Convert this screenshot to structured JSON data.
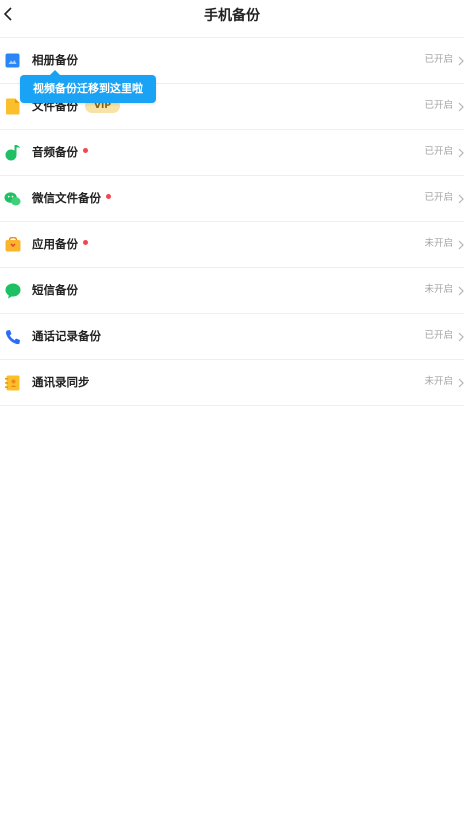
{
  "header": {
    "title": "手机备份",
    "back_icon": "chevron-left-icon"
  },
  "tooltip": {
    "text": "视频备份迁移到这里啦",
    "color": "#1aa3f5"
  },
  "items": [
    {
      "label": "相册备份",
      "status": "已开启",
      "icon": "album-icon",
      "badge": null,
      "dot": false
    },
    {
      "label": "文件备份",
      "status": "已开启",
      "icon": "file-icon",
      "badge": "VIP",
      "dot": false
    },
    {
      "label": "音频备份",
      "status": "已开启",
      "icon": "music-icon",
      "badge": null,
      "dot": true
    },
    {
      "label": "微信文件备份",
      "status": "已开启",
      "icon": "wechat-icon",
      "badge": null,
      "dot": true
    },
    {
      "label": "应用备份",
      "status": "未开启",
      "icon": "app-icon",
      "badge": null,
      "dot": true
    },
    {
      "label": "短信备份",
      "status": "未开启",
      "icon": "sms-icon",
      "badge": null,
      "dot": false
    },
    {
      "label": "通话记录备份",
      "status": "已开启",
      "icon": "phone-icon",
      "badge": null,
      "dot": false
    },
    {
      "label": "通讯录同步",
      "status": "未开启",
      "icon": "contacts-icon",
      "badge": null,
      "dot": false
    }
  ],
  "colors": {
    "dot": "#f5454f",
    "status": "#a5a5a5",
    "vip_bg": "#f7e3a6"
  }
}
